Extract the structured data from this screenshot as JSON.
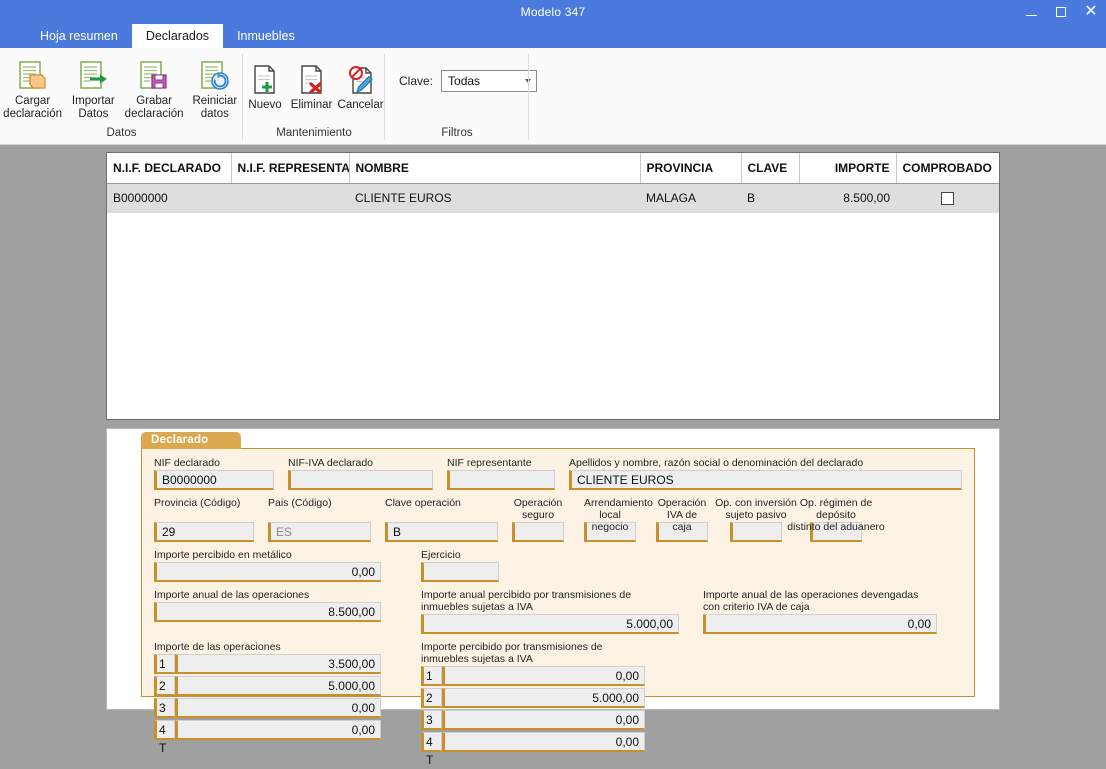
{
  "window": {
    "title": "Modelo 347",
    "minimize_label": "Minimizar",
    "maximize_label": "Maximizar",
    "close_label": "Cerrar"
  },
  "ribbon": {
    "tabs": [
      {
        "label": "Hoja resumen",
        "active": false
      },
      {
        "label": "Declarados",
        "active": true
      },
      {
        "label": "Inmuebles",
        "active": false
      }
    ],
    "groups": [
      {
        "title": "Datos",
        "buttons": [
          {
            "label": "Cargar\ndeclaración",
            "icon": "document-open-icon"
          },
          {
            "label": "Importar\nDatos",
            "icon": "document-import-icon"
          },
          {
            "label": "Grabar\ndeclaración",
            "icon": "document-save-icon"
          },
          {
            "label": "Reiniciar\ndatos",
            "icon": "document-refresh-icon"
          }
        ]
      },
      {
        "title": "Mantenimiento",
        "buttons": [
          {
            "label": "Nuevo",
            "icon": "document-new-icon"
          },
          {
            "label": "Eliminar",
            "icon": "document-delete-icon"
          },
          {
            "label": "Cancelar",
            "icon": "document-cancel-icon"
          }
        ]
      },
      {
        "title": "Filtros",
        "filter_label": "Clave:",
        "filter_value": "Todas"
      }
    ]
  },
  "grid": {
    "columns": [
      {
        "label": "N.I.F. DECLARADO",
        "align": "left"
      },
      {
        "label": "N.I.F. REPRESENTA...",
        "align": "left"
      },
      {
        "label": "NOMBRE",
        "align": "left"
      },
      {
        "label": "PROVINCIA",
        "align": "left"
      },
      {
        "label": "CLAVE",
        "align": "left"
      },
      {
        "label": "IMPORTE",
        "align": "right"
      },
      {
        "label": "COMPROBADO",
        "align": "left"
      }
    ],
    "rows": [
      {
        "nif_declarado": "B0000000",
        "nif_representante": "",
        "nombre": "CLIENTE EUROS",
        "provincia": "MALAGA",
        "clave": "B",
        "importe": "8.500,00",
        "comprobado": false
      }
    ]
  },
  "detail": {
    "tab_label": "Declarado",
    "fields": {
      "nif_declarado": {
        "label": "NIF declarado",
        "value": "B0000000"
      },
      "nif_iva_declarado": {
        "label": "NIF-IVA declarado",
        "value": ""
      },
      "nif_representante": {
        "label": "NIF representante",
        "value": ""
      },
      "apellidos_nombre": {
        "label": "Apellidos y nombre, razón social o denominación del declarado",
        "value": "CLIENTE EUROS"
      },
      "provincia_codigo": {
        "label": "Provincia (Código)",
        "value": "29"
      },
      "pais_codigo": {
        "label": "Pais (Código)",
        "value": "ES",
        "is_placeholder": true
      },
      "clave_operacion": {
        "label": "Clave operación",
        "value": "B"
      },
      "operacion_seguro": {
        "label": "Operación\nseguro",
        "value": ""
      },
      "arrendamiento_local": {
        "label": "Arrendamiento\nlocal negocio",
        "value": ""
      },
      "operacion_iva_caja": {
        "label": "Operación\nIVA de caja",
        "value": ""
      },
      "op_inversion_sujeto_pasivo": {
        "label": "Op. con inversión\nsujeto pasivo",
        "value": ""
      },
      "op_regimen_deposito": {
        "label": "Op. régimen de depósito\ndistinto del aduanero",
        "value": ""
      },
      "importe_metalico": {
        "label": "Importe percibido en metálico",
        "value": "0,00"
      },
      "ejercicio": {
        "label": "Ejercicio",
        "value": ""
      },
      "importe_anual_operaciones": {
        "label": "Importe anual de las operaciones",
        "value": "8.500,00"
      },
      "importe_anual_transmisiones": {
        "label": "Importe anual percibido por transmisiones de inmuebles sujetas a IVA",
        "value": "5.000,00"
      },
      "importe_anual_iva_caja": {
        "label": "Importe anual de las operaciones devengadas con criterio IVA de caja",
        "value": "0,00"
      }
    },
    "quarters_operaciones": {
      "label": "Importe de las operaciones",
      "rows": [
        {
          "period": "1 T",
          "value": "3.500,00"
        },
        {
          "period": "2 T",
          "value": "5.000,00"
        },
        {
          "period": "3 T",
          "value": "0,00"
        },
        {
          "period": "4 T",
          "value": "0,00"
        }
      ]
    },
    "quarters_transmisiones": {
      "label": "Importe percibido por transmisiones de inmuebles sujetas a IVA",
      "rows": [
        {
          "period": "1 T",
          "value": "0,00"
        },
        {
          "period": "2 T",
          "value": "5.000,00"
        },
        {
          "period": "3 T",
          "value": "0,00"
        },
        {
          "period": "4 T",
          "value": "0,00"
        }
      ]
    }
  },
  "colors": {
    "titlebar": "#4a7ade",
    "accent_orange": "#c98f2a",
    "panel_cream": "#fdf3e5",
    "tab_orange": "#dba74f",
    "row_selected": "#dedede"
  }
}
